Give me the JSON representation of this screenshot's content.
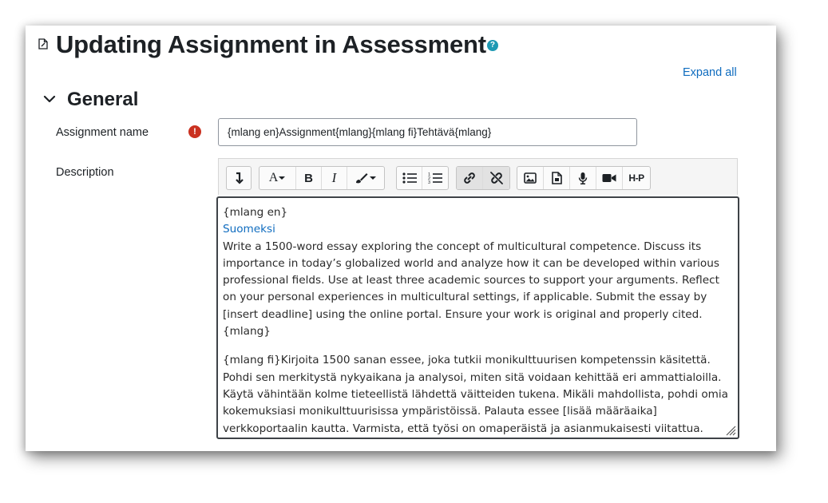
{
  "page": {
    "title": "Updating Assignment in Assessment",
    "help_icon": "question-circle-icon",
    "expand_all": "Expand all"
  },
  "section": {
    "title": "General",
    "icon": "chevron-down-icon"
  },
  "fields": {
    "assignment_name_label": "Assignment name",
    "assignment_name_value": "{mlang en}Assignment{mlang}{mlang fi}Tehtävä{mlang}",
    "required_icon": "exclamation-circle-icon",
    "description_label": "Description"
  },
  "toolbar": [
    {
      "name": "show-more-buttons",
      "icon": "collapse-icon"
    },
    {
      "name": "text-style",
      "label": "A"
    },
    {
      "name": "bold",
      "label": "B"
    },
    {
      "name": "italic",
      "label": "I"
    },
    {
      "name": "text-colour",
      "icon": "paintbrush-icon"
    },
    {
      "name": "unordered-list",
      "icon": "bullet-list-icon"
    },
    {
      "name": "ordered-list",
      "icon": "numbered-list-icon"
    },
    {
      "name": "link",
      "icon": "link-icon"
    },
    {
      "name": "unlink",
      "icon": "unlink-icon"
    },
    {
      "name": "insert-image",
      "icon": "image-icon"
    },
    {
      "name": "insert-media",
      "icon": "file-icon"
    },
    {
      "name": "record-audio",
      "icon": "microphone-icon"
    },
    {
      "name": "record-video",
      "icon": "video-camera-icon"
    },
    {
      "name": "insert-h5p",
      "label": "H-P"
    }
  ],
  "editor": {
    "line1": "{mlang en}",
    "line2": "Suomeksi",
    "para_en": "Write a 1500-word essay exploring the concept of multicultural competence. Discuss its importance in today’s globalized world and analyze how it can be developed within various professional fields. Use at least three academic sources to support your arguments. Reflect on your personal experiences in multicultural settings, if applicable. Submit the essay by [insert deadline] using the online portal. Ensure your work is original and properly cited.{mlang}",
    "para_fi": "{mlang fi}Kirjoita 1500 sanan essee, joka tutkii monikulttuurisen kompetenssin käsitettä. Pohdi sen merkitystä nykyaikana ja analysoi, miten sitä voidaan kehittää eri ammattialoilla. Käytä vähintään kolme tieteellistä lähdettä väitteiden tukena. Mikäli mahdollista, pohdi omia kokemuksiasi monikulttuurisissa ympäristöissä. Palauta essee [lisää määräaika] verkkoportaalin kautta. Varmista, että työsi on omaperäistä ja asianmukaisesti viitattua.{mlang}",
    "resize_icon": "resize-handle-icon"
  },
  "colors": {
    "link": "#0f6cbf",
    "required": "#ca3120",
    "help": "#1f99b3",
    "text": "#1d2125"
  }
}
